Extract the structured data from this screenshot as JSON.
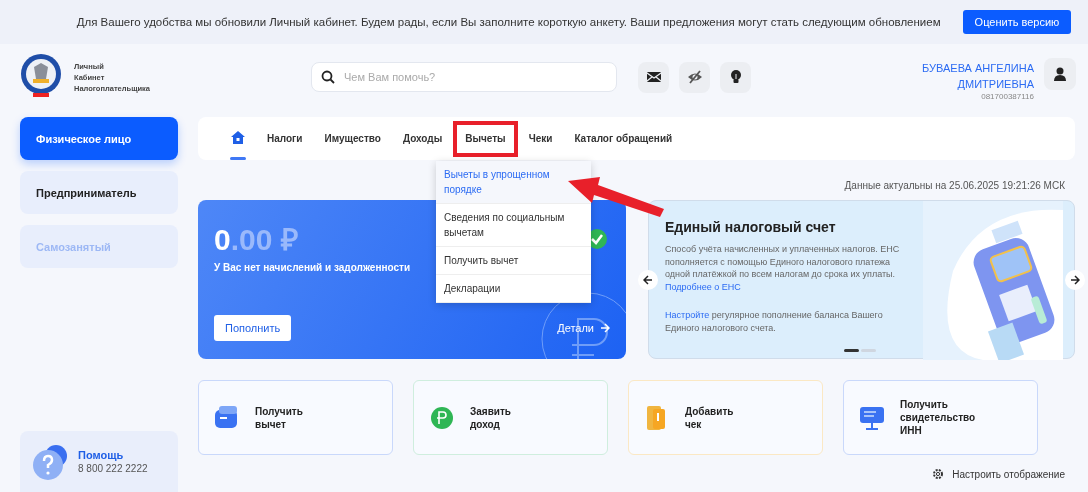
{
  "banner": {
    "text": "Для Вашего удобства мы обновили Личный кабинет. Будем рады, если Вы заполните короткую анкету. Ваши предложения могут стать следующим обновлением",
    "button": "Оценить версию"
  },
  "header": {
    "logo_lines": [
      "Личный",
      "Кабинет",
      "Налогоплательщика"
    ],
    "search": {
      "placeholder": "Чем Вам помочь?"
    },
    "tools": [
      {
        "kind": "mail"
      },
      {
        "kind": "eye-off"
      },
      {
        "kind": "bulb"
      }
    ],
    "user": {
      "name_lines": [
        "БУВАЕВА АНГЕЛИНА",
        "ДМИТРИЕВНА"
      ],
      "inn": "081700387116"
    }
  },
  "sidebar": {
    "items": [
      {
        "label": "Физическое лицо",
        "selected": true,
        "disabled": false
      },
      {
        "label": "Предприниматель",
        "selected": false,
        "disabled": false
      },
      {
        "label": "Самозанятый",
        "selected": false,
        "disabled": true
      }
    ],
    "help": {
      "title": "Помощь",
      "phone": "8 800 222 2222"
    }
  },
  "nav": {
    "tabs": [
      {
        "kind": "home",
        "selected": true,
        "annotated": false
      },
      {
        "kind": "text",
        "label": "Налоги",
        "selected": false,
        "annotated": false
      },
      {
        "kind": "text",
        "label": "Имущество",
        "selected": false,
        "annotated": false
      },
      {
        "kind": "text",
        "label": "Доходы",
        "selected": false,
        "annotated": false
      },
      {
        "kind": "text",
        "label": "Вычеты",
        "selected": false,
        "annotated": true
      },
      {
        "kind": "text",
        "label": "Чеки",
        "selected": false,
        "annotated": false
      },
      {
        "kind": "text",
        "label": "Каталог обращений",
        "selected": false,
        "annotated": false
      }
    ],
    "dropdown": {
      "items": [
        {
          "label": "Вычеты в упрощенном порядке",
          "selected": true
        },
        {
          "label": "Сведения по социальным вычетам",
          "selected": false
        },
        {
          "label": "Получить вычет",
          "selected": false
        },
        {
          "label": "Декларации",
          "selected": false
        }
      ]
    },
    "annotation": {
      "kind": "arrow"
    }
  },
  "updated": "Данные актуальны на 25.06.2025 19:21:26 МСК",
  "balance": {
    "amount_integer": "0",
    "amount_fraction": ".00 ₽",
    "caption": "У Вас нет начислений и задолженности",
    "button": "Пополнить",
    "details": "Детали"
  },
  "ens": {
    "title": "Единый налоговый счет",
    "description": "Способ учёта начисленных и уплаченных налогов. ЕНС пополняется с помощью Единого налогового платежа одной платёжкой по всем налогам до срока их уплаты.",
    "more_link": "Подробнее о ЕНС",
    "setup_link": "Настройте",
    "setup_text": "регулярное пополнение баланса Вашего Единого налогового счета.",
    "slides": [
      {
        "selected": true
      },
      {
        "selected": false
      }
    ]
  },
  "actions": [
    {
      "kind": "wallet",
      "lines": [
        "Получить",
        "вычет"
      ],
      "color": "#c9d8fb"
    },
    {
      "kind": "ruble",
      "lines": [
        "Заявить",
        "доход"
      ],
      "color": "#cfeede"
    },
    {
      "kind": "receipt",
      "lines": [
        "Добавить",
        "чек"
      ],
      "color": "#fbe8c4"
    },
    {
      "kind": "monitor",
      "lines": [
        "Получить",
        "свидетельство",
        "ИНН"
      ],
      "color": "#c9d8fb"
    }
  ],
  "display_settings": "Настроить отображение"
}
